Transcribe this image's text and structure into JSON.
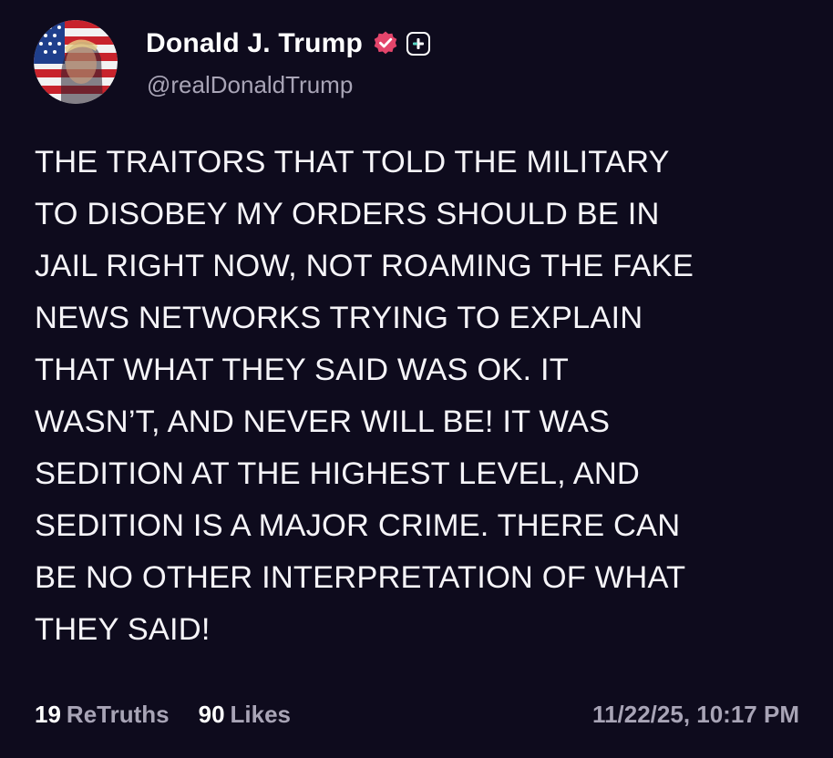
{
  "author": {
    "display_name": "Donald J. Trump",
    "handle": "@realDonaldTrump",
    "verified_icon": "verified-badge-icon",
    "plus_icon": "plus-icon"
  },
  "post": {
    "text": "THE TRAITORS THAT TOLD THE MILITARY\nTO DISOBEY MY ORDERS SHOULD BE IN\nJAIL RIGHT NOW, NOT ROAMING THE FAKE\nNEWS NETWORKS TRYING TO EXPLAIN\nTHAT WHAT THEY SAID WAS OK. IT\nWASN’T, AND NEVER WILL BE! IT WAS\nSEDITION AT THE HIGHEST LEVEL, AND\nSEDITION IS A MAJOR CRIME. THERE CAN\nBE NO OTHER INTERPRETATION OF WHAT\nTHEY SAID!"
  },
  "stats": {
    "retruths_count": "19",
    "retruths_label": "ReTruths",
    "likes_count": "90",
    "likes_label": "Likes"
  },
  "timestamp": "11/22/25, 10:17 PM",
  "colors": {
    "background": "#0e0b1d",
    "text": "#ffffff",
    "muted": "#a8a4b6",
    "verified": "#e3456b"
  }
}
